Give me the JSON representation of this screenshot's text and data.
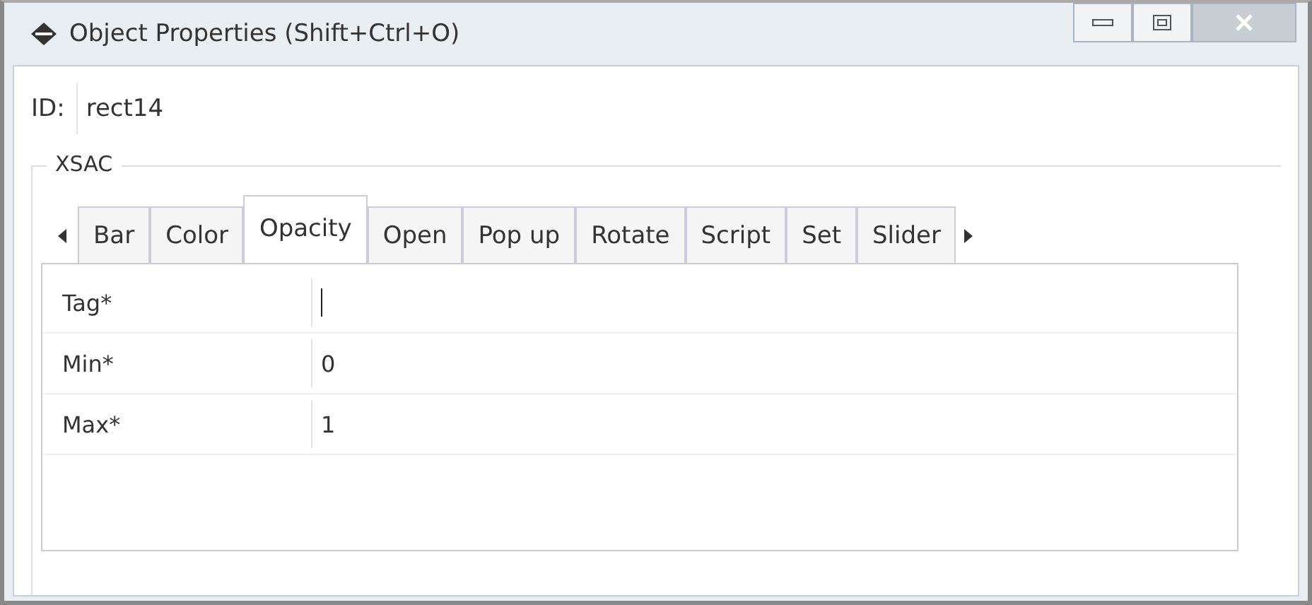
{
  "window": {
    "title": "Object Properties (Shift+Ctrl+O)"
  },
  "id_field": {
    "label": "ID:",
    "value": "rect14"
  },
  "group": {
    "title": "XSAC"
  },
  "tabs": [
    {
      "label": "Bar",
      "selected": false
    },
    {
      "label": "Color",
      "selected": false
    },
    {
      "label": "Opacity",
      "selected": true
    },
    {
      "label": "Open",
      "selected": false
    },
    {
      "label": "Pop up",
      "selected": false
    },
    {
      "label": "Rotate",
      "selected": false
    },
    {
      "label": "Script",
      "selected": false
    },
    {
      "label": "Set",
      "selected": false
    },
    {
      "label": "Slider",
      "selected": false
    }
  ],
  "fields": [
    {
      "label": "Tag*",
      "focused": true
    },
    {
      "label": "Min*",
      "value": "0",
      "focused": false
    },
    {
      "label": "Max*",
      "value": "1",
      "focused": false
    }
  ]
}
